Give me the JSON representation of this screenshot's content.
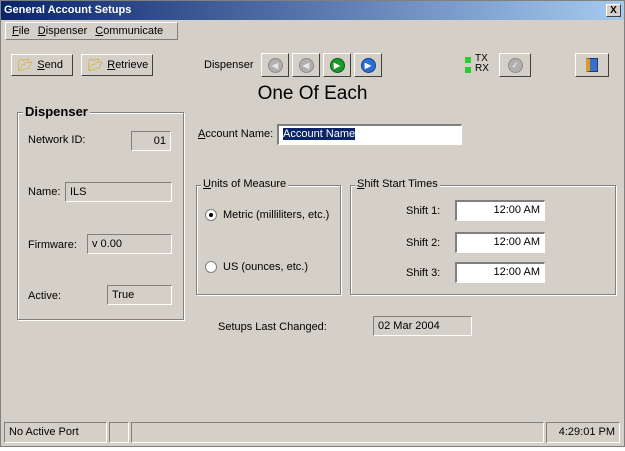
{
  "window": {
    "title": "General Account Setups",
    "close_glyph": "X"
  },
  "menu": {
    "items": [
      {
        "key": "F",
        "rest": "ile"
      },
      {
        "key": "D",
        "rest": "ispenser"
      },
      {
        "key": "C",
        "rest": "ommunicate"
      }
    ]
  },
  "toolbar": {
    "send": {
      "key": "S",
      "rest": "end"
    },
    "retrieve": {
      "key": "R",
      "rest": "etrieve"
    },
    "dispenser_label": "Dispenser",
    "tx_label": "TX",
    "rx_label": "RX"
  },
  "heading": "One Of Each",
  "dispenser_group": {
    "title": "Dispenser",
    "network_id_label": "Network ID:",
    "network_id_value": "01",
    "name_label": "Name:",
    "name_value": "ILS",
    "firmware_label": "Firmware:",
    "firmware_value": "v 0.00",
    "active_label": "Active:",
    "active_value": "True"
  },
  "account": {
    "label_key": "A",
    "label_rest": "ccount Name:",
    "value": "Account Name"
  },
  "units": {
    "title_key": "U",
    "title_rest": "nits of Measure",
    "metric_label": "Metric (milliliters, etc.)",
    "us_label": "US (ounces, etc.)",
    "selected": "metric"
  },
  "shifts": {
    "title_key": "S",
    "title_rest": "hift Start Times",
    "items": [
      {
        "label": "Shift 1:",
        "value": "12:00 AM"
      },
      {
        "label": "Shift 2:",
        "value": "12:00 AM"
      },
      {
        "label": "Shift 3:",
        "value": "12:00 AM"
      }
    ]
  },
  "setups": {
    "label": "Setups Last Changed:",
    "value": "02 Mar 2004"
  },
  "status": {
    "port": "No Active Port",
    "time": "4:29:01 PM"
  },
  "colors": {
    "titlebar_start": "#0a246a",
    "titlebar_end": "#a6caf0",
    "face": "#d4d0c8",
    "led": "#2dcc2d"
  },
  "icons": [
    "send-icon",
    "retrieve-icon",
    "first-record-icon",
    "previous-record-icon",
    "next-record-icon",
    "last-record-icon",
    "tx-led-icon",
    "rx-led-icon",
    "connect-icon",
    "exit-door-icon",
    "close-icon"
  ]
}
